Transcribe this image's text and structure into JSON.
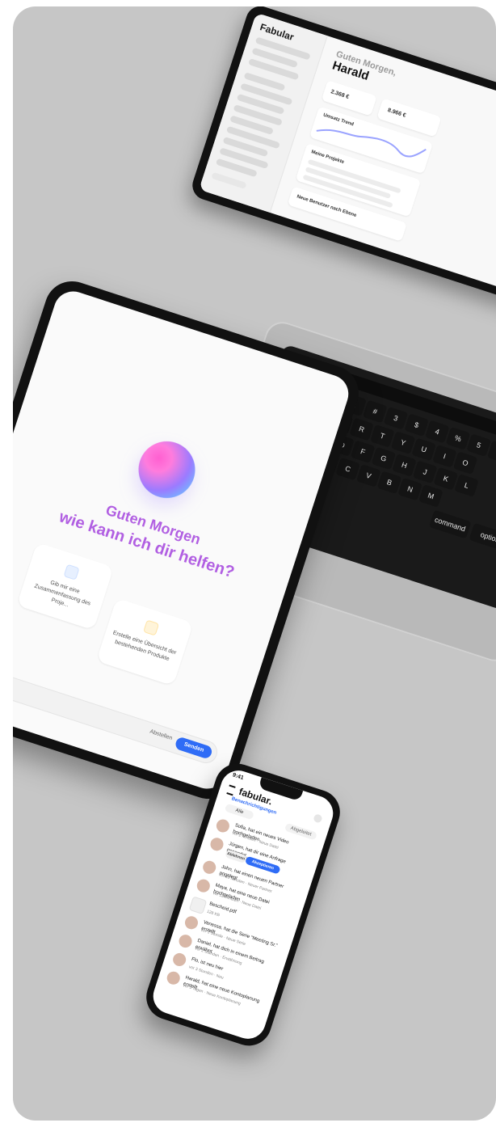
{
  "tablet": {
    "title_line1": "Guten Morgen",
    "title_line2": "wie kann ich dir helfen?",
    "cards": [
      {
        "label": "Gib mir eine Zusammenfassung des Proje..."
      },
      {
        "label": "Erstelle eine Übersicht der bestehenden Produkte"
      }
    ],
    "bottom": {
      "hint": "Abstellen",
      "send": "Senden"
    }
  },
  "laptop": {
    "brand": "Fabular",
    "greeting": "Guten Morgen,",
    "name": "Harald",
    "kpi_1": "2.368 €",
    "kpi_2": "8.966 €",
    "section_1": "Umsatz Trend",
    "section_2": "Meine Projekte",
    "section_3": "Neue Benutzer nach Ebene"
  },
  "keyboard": {
    "keys": [
      "!",
      "1",
      "@",
      "2",
      "#",
      "3",
      "$",
      "4",
      "%",
      "5",
      "^",
      "6",
      "&",
      "7",
      "*",
      "8",
      "(",
      "9",
      "Q",
      "W",
      "E",
      "R",
      "T",
      "Y",
      "U",
      "I",
      "O",
      "A",
      "S",
      "D",
      "F",
      "G",
      "H",
      "J",
      "K",
      "L",
      "Z",
      "X",
      "C",
      "V",
      "B",
      "N",
      "M",
      "command",
      "option"
    ]
  },
  "phone": {
    "time": "9:41",
    "brand": "fabular.",
    "breadcrumb": "Benachrichtigungen",
    "filters": [
      "Alle",
      "Abgeleitet"
    ],
    "items": [
      {
        "title": "Sofia, hat ein neues Video hochgeladen",
        "sub": "vor 2 Minuten · Neue Datei",
        "type": "avatar"
      },
      {
        "title": "Jürgen, hat dir eine Anfrage gesendet",
        "sub": "vor 5 Minuten · Neue Anfrage",
        "type": "action",
        "actions": [
          "Ablehnen",
          "Akzeptieren"
        ]
      },
      {
        "title": "John, hat einen neuen Partner angelegt",
        "sub": "vor 10 Minuten · Neuer Partner",
        "type": "avatar"
      },
      {
        "title": "Maya, hat eine neue Datei hochgeladen",
        "sub": "vor 12 Minuten · Neue Datei",
        "type": "file"
      },
      {
        "title": "Bescheid.pdf",
        "sub": "128 KB",
        "type": "doc"
      },
      {
        "title": "Vanessa, hat die Serie “Meeting Sr.” erstellt",
        "sub": "vor 1 Stunde · Neue Serie",
        "type": "avatar"
      },
      {
        "title": "Daniel, hat dich in einem Beitrag erwähnt",
        "sub": "vor 2 Stunden · Erwähnung",
        "type": "avatar"
      },
      {
        "title": "Flo, ist neu hier",
        "sub": "vor 3 Stunden · Neu",
        "type": "avatar"
      },
      {
        "title": "Harald, hat eine neue Kontoplanung erstellt",
        "sub": "vor 5 Tagen · Neue Kontoplanung",
        "type": "avatar"
      }
    ]
  }
}
